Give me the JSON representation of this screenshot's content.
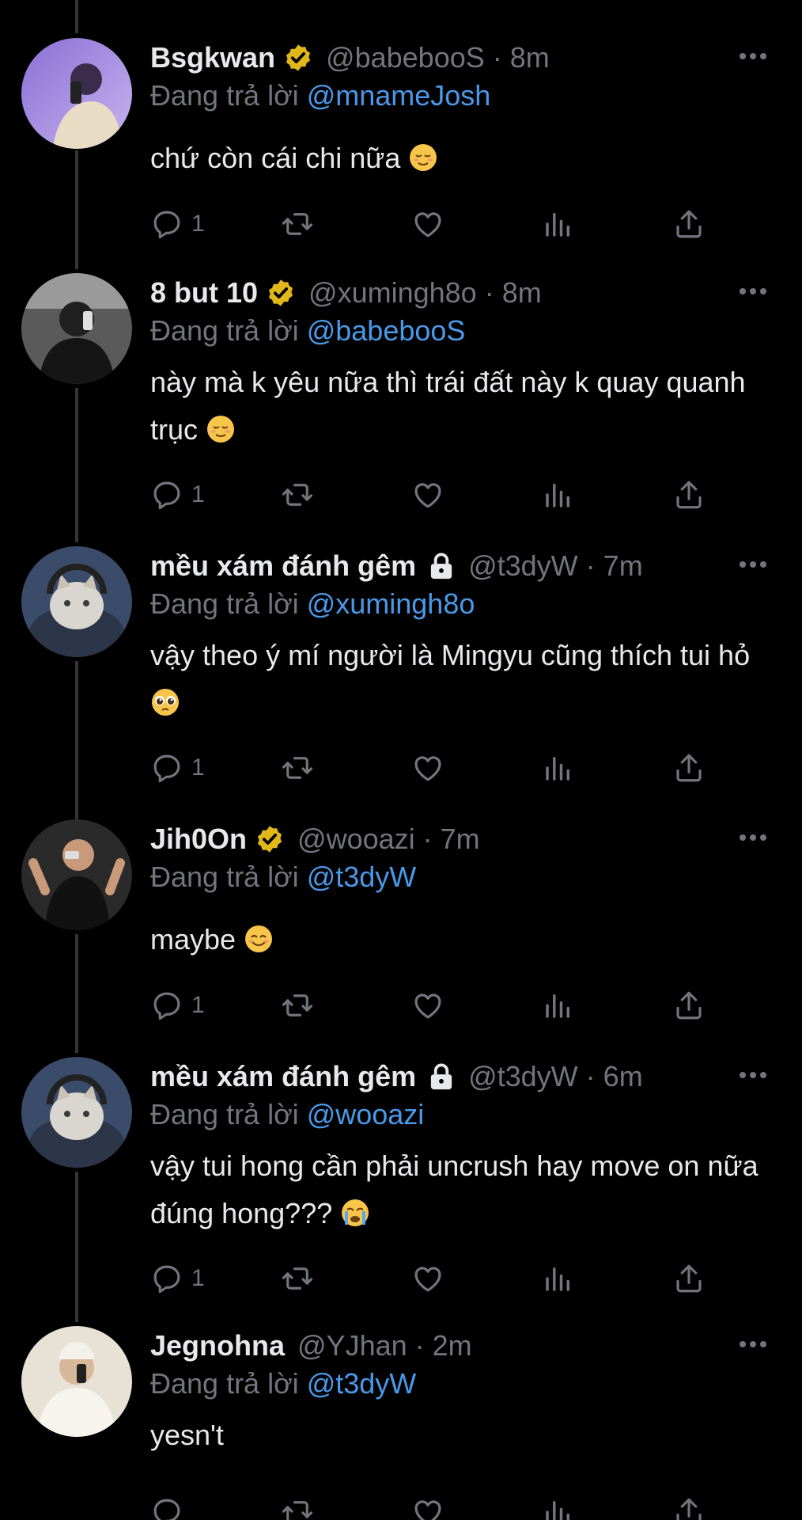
{
  "reply_prefix": "Đang trả lời",
  "tweets": [
    {
      "display_name": "Bsgkwan",
      "verified": true,
      "protected": false,
      "handle": "@babebooS",
      "time": "8m",
      "reply_to": "@mnameJosh",
      "text": "chứ còn cái chi nữa",
      "emoji": "relieved-face",
      "reply_count": "1"
    },
    {
      "display_name": "8 but 10",
      "verified": true,
      "protected": false,
      "handle": "@xumingh8o",
      "time": "8m",
      "reply_to": "@babebooS",
      "text": "này mà k yêu nữa thì trái đất này k quay quanh trục",
      "emoji": "relieved-face",
      "reply_count": "1"
    },
    {
      "display_name": "mều xám đánh gêm",
      "verified": false,
      "protected": true,
      "handle": "@t3dyW",
      "time": "7m",
      "reply_to": "@xumingh8o",
      "text": "vậy theo ý mí người là Mingyu cũng thích tui hỏ",
      "emoji": "pleading-face",
      "reply_count": "1"
    },
    {
      "display_name": "Jih0On",
      "verified": true,
      "protected": false,
      "handle": "@wooazi",
      "time": "7m",
      "reply_to": "@t3dyW",
      "text": "maybe",
      "emoji": "smiling-face",
      "reply_count": "1"
    },
    {
      "display_name": "mều xám đánh gêm",
      "verified": false,
      "protected": true,
      "handle": "@t3dyW",
      "time": "6m",
      "reply_to": "@wooazi",
      "text": "vậy tui hong cần phải uncrush hay move on nữa đúng hong???",
      "emoji": "crying-face",
      "reply_count": "1"
    },
    {
      "display_name": "Jegnohna",
      "verified": false,
      "protected": false,
      "handle": "@YJhan",
      "time": "2m",
      "reply_to": "@t3dyW",
      "text": "yesn't",
      "emoji": "",
      "reply_count": ""
    }
  ],
  "colors": {
    "background": "#000000",
    "text": "#e7e9ea",
    "muted": "#71767b",
    "link": "#4a99e9",
    "verified_badge": "#e2b719",
    "thread_line": "#333639"
  },
  "icons": {
    "reply": "reply-icon",
    "retweet": "retweet-icon",
    "like": "heart-icon",
    "views": "views-icon",
    "share": "share-icon",
    "more": "more-icon",
    "verified": "verified-badge-icon",
    "protected": "lock-icon"
  }
}
